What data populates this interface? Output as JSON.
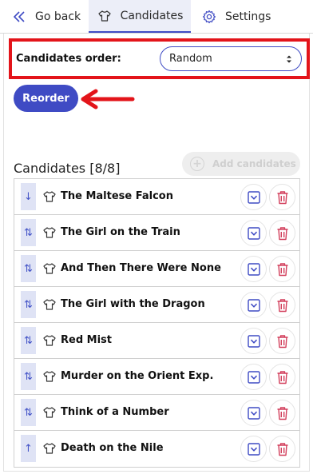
{
  "nav": {
    "go_back": "Go back",
    "candidates": "Candidates",
    "settings": "Settings"
  },
  "order": {
    "label": "Candidates order:",
    "selected": "Random",
    "reorder": "Reorder"
  },
  "candidates": {
    "title": "Candidates [8/8]",
    "add_label": "Add candidates",
    "items": [
      {
        "title": "The Maltese Falcon",
        "handle": "↓"
      },
      {
        "title": "The Girl on the Train",
        "handle": "⇅"
      },
      {
        "title": "And Then There Were None",
        "handle": "⇅"
      },
      {
        "title": "The Girl with the Dragon",
        "handle": "⇅"
      },
      {
        "title": "Red Mist",
        "handle": "⇅"
      },
      {
        "title": "Murder on the Orient Exp.",
        "handle": "⇅"
      },
      {
        "title": "Think of a Number",
        "handle": "⇅"
      },
      {
        "title": "Death on the Nile",
        "handle": "↑"
      }
    ]
  },
  "colors": {
    "accent": "#3f4bc4",
    "highlight": "#e3141a",
    "delete": "#d23d5a"
  }
}
